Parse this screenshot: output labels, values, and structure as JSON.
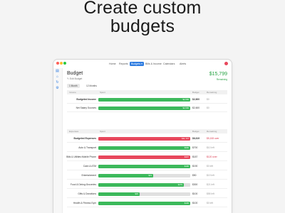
{
  "headline": {
    "line1": "Create custom",
    "line2": "budgets"
  },
  "colors": {
    "accent": "#2f7de1",
    "positive": "#27a344",
    "negative": "#d9344b",
    "bar_green": "#3cb95b",
    "bar_red": "#e8475c",
    "traffic_close": "#fd5f57",
    "traffic_min": "#febc2e",
    "traffic_max": "#29c841"
  },
  "nav": {
    "items": [
      "Home",
      "Reports",
      "Budgets",
      "Bills & Income",
      "Calendars",
      "Alerts"
    ],
    "active_index": 2,
    "avatar_icon": "avatar-icon"
  },
  "rail": {
    "icons": [
      "sidebar-toggle-icon",
      "home-icon",
      "refresh-icon",
      "settings-icon"
    ]
  },
  "budget": {
    "title": "Budget",
    "edit_label": "Edit Budget",
    "amount": "$15,799",
    "remaining_label": "Remaining",
    "tabs": [
      "1 Month",
      "12 Months"
    ],
    "selected_tab": 0
  },
  "income": {
    "headers": {
      "name": "Income",
      "spent": "Spent",
      "budget": "Budget",
      "remaining": "Remaining"
    },
    "rows": [
      {
        "label": "Budgeted Income",
        "bold": true,
        "progress": 1.0,
        "bar_value": "$2,600",
        "budget": "$2,600",
        "remaining": "$0",
        "color": "green",
        "rem_color": "grey"
      },
      {
        "label": "Net Salary Sources",
        "bold": false,
        "progress": 1.0,
        "bar_value": "$2,600",
        "budget": "$2,600",
        "remaining": "$0",
        "color": "green",
        "rem_color": "grey"
      }
    ]
  },
  "expenses": {
    "headers": {
      "name": "Expenses",
      "spent": "Spent",
      "budget": "Budget",
      "remaining": "Remaining"
    },
    "rows": [
      {
        "label": "Budgeted Expenses",
        "bold": true,
        "progress": 1.0,
        "bar_value": "$11,727",
        "budget": "$6,619",
        "remaining": "$5,108 over",
        "color": "red",
        "rem_color": "red"
      },
      {
        "label": "Auto & Transport",
        "bold": false,
        "progress": 1.0,
        "bar_value": "$690",
        "budget": "$700",
        "remaining": "$10 left",
        "color": "green",
        "rem_color": "grey"
      },
      {
        "label": "Bills & Utilities:Mobile Phone",
        "bold": false,
        "progress": 1.0,
        "bar_value": "$307",
        "budget": "$187",
        "remaining": "$120 over",
        "color": "red",
        "rem_color": "red"
      },
      {
        "label": "Cash & ATM",
        "bold": false,
        "progress": 1.0,
        "bar_value": "$190",
        "budget": "$190",
        "remaining": "$0 left",
        "color": "green",
        "rem_color": "grey"
      },
      {
        "label": "Entertainment",
        "bold": false,
        "progress": 0.6,
        "bar_value": "$31",
        "budget": "$50",
        "remaining": "$19 left",
        "color": "green",
        "rem_color": "grey"
      },
      {
        "label": "Food & Dining:Groceries",
        "bold": false,
        "progress": 0.93,
        "bar_value": "$279",
        "budget": "$300",
        "remaining": "$21 left",
        "color": "green",
        "rem_color": "grey"
      },
      {
        "label": "Gifts & Donations",
        "bold": false,
        "progress": 0.45,
        "bar_value": "$45",
        "budget": "$100",
        "remaining": "$55 left",
        "color": "green",
        "rem_color": "grey"
      },
      {
        "label": "Health & Fitness:Gym",
        "bold": false,
        "progress": 1.0,
        "bar_value": "$100",
        "budget": "$100",
        "remaining": "$0 left",
        "color": "green",
        "rem_color": "grey"
      }
    ]
  }
}
